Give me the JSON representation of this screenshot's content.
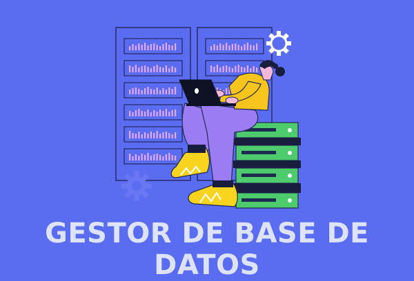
{
  "title": "GESTOR DE BASE DE DATOS",
  "colors": {
    "background": "#5a6cf0",
    "rack_line": "#23275a",
    "rack_bar": "#e6a8f5",
    "gear_white": "#ffffff",
    "gear_faded": "#7b87f5",
    "shirt": "#f8c51e",
    "pants": "#9b7cf2",
    "skin": "#f2b7d9",
    "shoe": "#f8d41e",
    "server_green": "#4ecb6c",
    "title_text": "#dde3ff"
  },
  "illustration": {
    "left_rack_icon": "server-rack-icon",
    "right_rack_icon": "server-rack-icon",
    "top_gear_icon": "gear-icon",
    "bottom_gear_icon": "gear-icon",
    "laptop_icon": "laptop-icon",
    "server_stack_icon": "server-stack-icon"
  }
}
